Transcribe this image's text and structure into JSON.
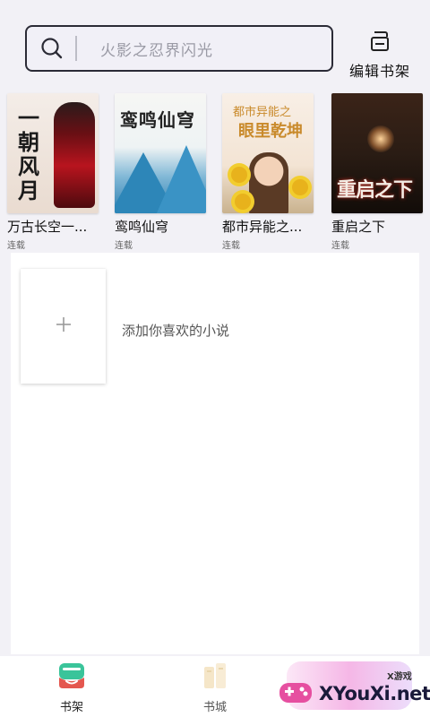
{
  "search": {
    "placeholder": "火影之忍界闪光"
  },
  "header": {
    "edit_shelf_label": "编辑书架"
  },
  "books": [
    {
      "title": "万古长空一...",
      "status": "连载",
      "cover_text": "一朝风月"
    },
    {
      "title": "鸾鸣仙穹",
      "status": "连载",
      "cover_text": "鸾鸣仙穹"
    },
    {
      "title": "都市异能之...",
      "status": "连载",
      "cover_text_top": "都市异能之",
      "cover_text_main": "眼里乾坤"
    },
    {
      "title": "重启之下",
      "status": "连载",
      "cover_text": "重启之下"
    }
  ],
  "add": {
    "label": "添加你喜欢的小说",
    "plus": "+"
  },
  "bottom_nav": [
    {
      "label": "书架",
      "icon": "bookshelf-icon",
      "active": true
    },
    {
      "label": "书城",
      "icon": "bookstore-icon",
      "active": false
    }
  ],
  "watermark": {
    "brand": "XYouXi.net",
    "small": "X游戏"
  },
  "colors": {
    "accent_green": "#3ac49a",
    "accent_red": "#e4574f",
    "background": "#f2f1f6"
  }
}
